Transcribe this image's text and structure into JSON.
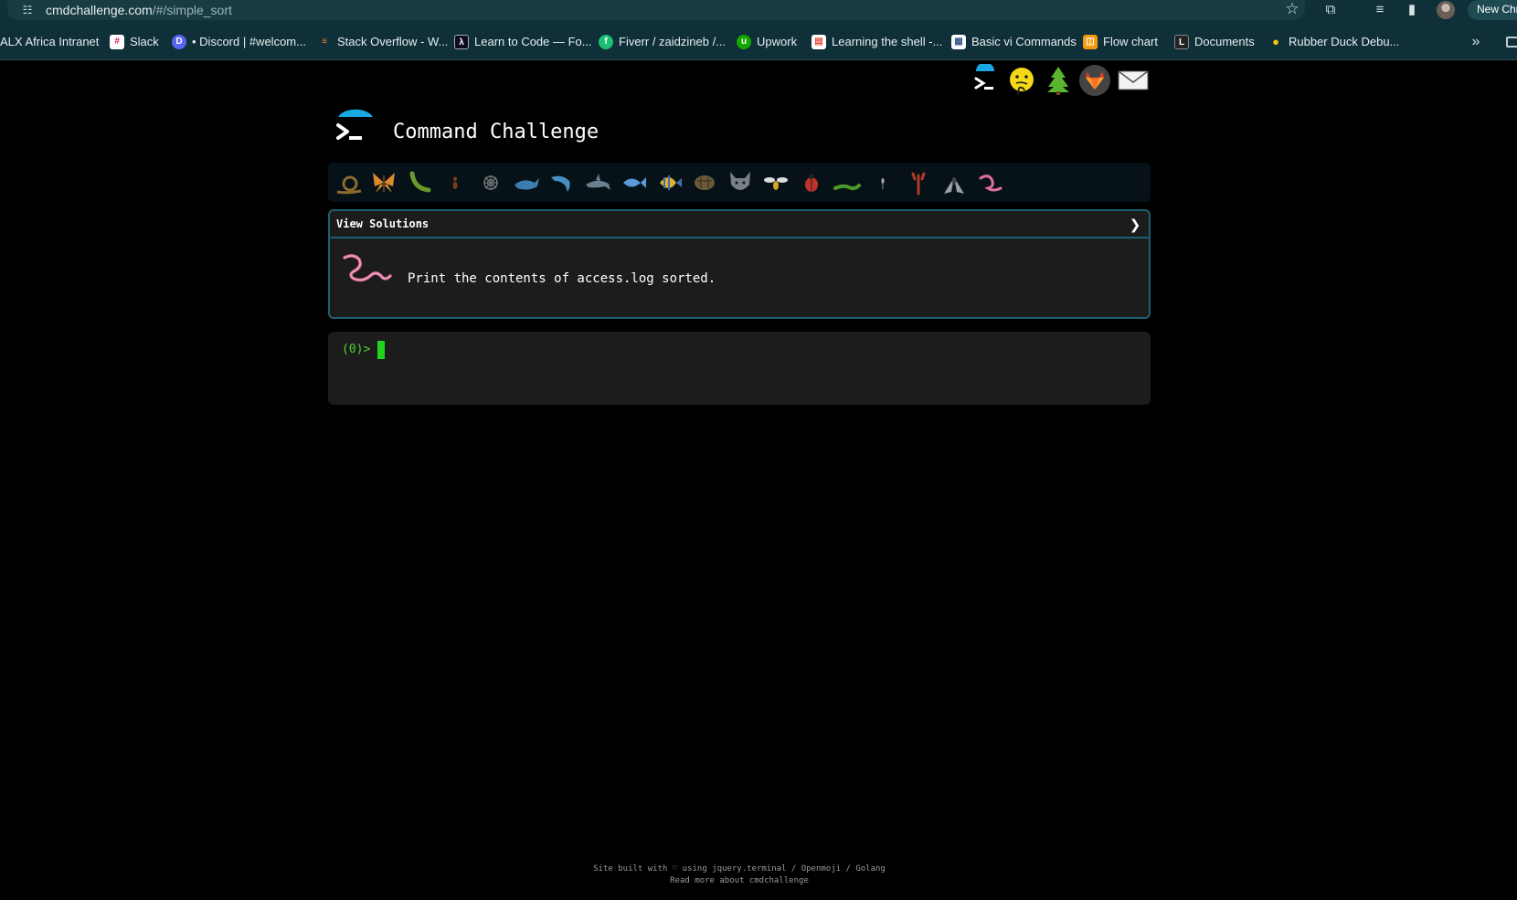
{
  "browser": {
    "url_host": "cmdchallenge.com",
    "url_path": "/#/simple_sort",
    "new_chrome_label": "New Chr",
    "bookmarks": [
      {
        "label": "ALX Africa Intranet",
        "icon": "none",
        "color": ""
      },
      {
        "label": "Slack",
        "icon": "slack-icon",
        "color": "#e01e5a"
      },
      {
        "label": "• Discord | #welcom...",
        "icon": "discord-icon",
        "color": "#5865f2"
      },
      {
        "label": "Stack Overflow - W...",
        "icon": "stackoverflow-icon",
        "color": "#f48024"
      },
      {
        "label": "Learn to Code — Fo...",
        "icon": "freecodecamp-icon",
        "color": "#0a0a23"
      },
      {
        "label": "Fiverr / zaidzineb /...",
        "icon": "fiverr-icon",
        "color": "#1dbf73"
      },
      {
        "label": "Upwork",
        "icon": "upwork-icon",
        "color": "#14a800"
      },
      {
        "label": "Learning the shell -...",
        "icon": "document-icon",
        "color": "#e74c3c"
      },
      {
        "label": "Basic vi Commands",
        "icon": "vi-icon",
        "color": "#3b5b8a"
      },
      {
        "label": "Flow chart",
        "icon": "flowchart-icon",
        "color": "#f39c12"
      },
      {
        "label": "Documents",
        "icon": "documents-icon",
        "color": "#222222"
      },
      {
        "label": "Rubber Duck Debu...",
        "icon": "duck-icon",
        "color": "#f1c40f"
      }
    ]
  },
  "page": {
    "title": "Command Challenge",
    "header_icons": [
      "terminal-icon",
      "thinking-face-icon",
      "tree-icon",
      "gitlab-icon",
      "mail-icon"
    ],
    "levels": [
      "snail-icon",
      "butterfly-icon",
      "caterpillar-icon",
      "ant-icon",
      "spider-web-icon",
      "whale-icon",
      "dolphin-icon",
      "shark-icon",
      "fish-icon",
      "tropical-fish-icon",
      "turtle-icon",
      "wolf-icon",
      "bee-icon",
      "ladybug-icon",
      "lizard-icon",
      "mosquito-icon",
      "scorpion-icon",
      "fly-icon",
      "worm-icon"
    ],
    "panel": {
      "view_solutions": "View Solutions",
      "chevron": "❯",
      "challenge_icon": "worm-icon",
      "task": "Print the contents of access.log sorted."
    },
    "terminal": {
      "prompt": "(0)>"
    },
    "footer": {
      "line1": "Site built with ♡ using jquery.terminal / Openmoji / Golang",
      "line2": "Read more about cmdchallenge"
    }
  }
}
